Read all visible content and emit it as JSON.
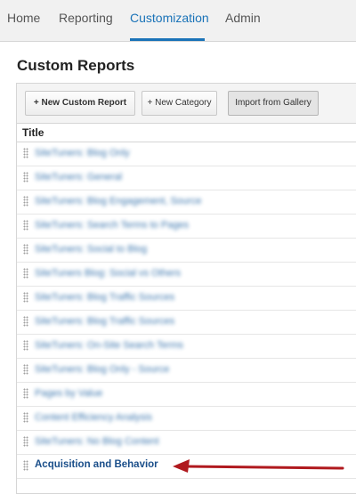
{
  "nav": {
    "tabs": [
      {
        "label": "Home",
        "active": false
      },
      {
        "label": "Reporting",
        "active": false
      },
      {
        "label": "Customization",
        "active": true
      },
      {
        "label": "Admin",
        "active": false
      }
    ],
    "accent_color": "#1a73b8"
  },
  "page": {
    "title": "Custom Reports"
  },
  "toolbar": {
    "new_report_label": "+ New Custom Report",
    "new_category_label": "+ New Category",
    "import_label": "Import from Gallery"
  },
  "table": {
    "column_title": "Title",
    "rows": [
      {
        "label": "SiteTuners: Blog Only",
        "blurred": true
      },
      {
        "label": "SiteTuners: General",
        "blurred": true
      },
      {
        "label": "SiteTuners: Blog Engagement, Source",
        "blurred": true
      },
      {
        "label": "SiteTuners: Search Terms to Pages",
        "blurred": true
      },
      {
        "label": "SiteTuners: Social to Blog",
        "blurred": true
      },
      {
        "label": "SiteTuners Blog: Social vs Others",
        "blurred": true
      },
      {
        "label": "SiteTuners: Blog Traffic Sources",
        "blurred": true
      },
      {
        "label": "SiteTuners: Blog Traffic Sources",
        "blurred": true
      },
      {
        "label": "SiteTuners: On-Site Search Terms",
        "blurred": true
      },
      {
        "label": "SiteTuners: Blog Only - Source",
        "blurred": true
      },
      {
        "label": "Pages by Value",
        "blurred": true
      },
      {
        "label": "Content Efficiency Analysis",
        "blurred": true
      },
      {
        "label": "SiteTuners: No Blog Content",
        "blurred": true
      },
      {
        "label": "Acquisition and Behavior",
        "blurred": false
      }
    ]
  },
  "annotation": {
    "arrow_color": "#b0191e"
  }
}
